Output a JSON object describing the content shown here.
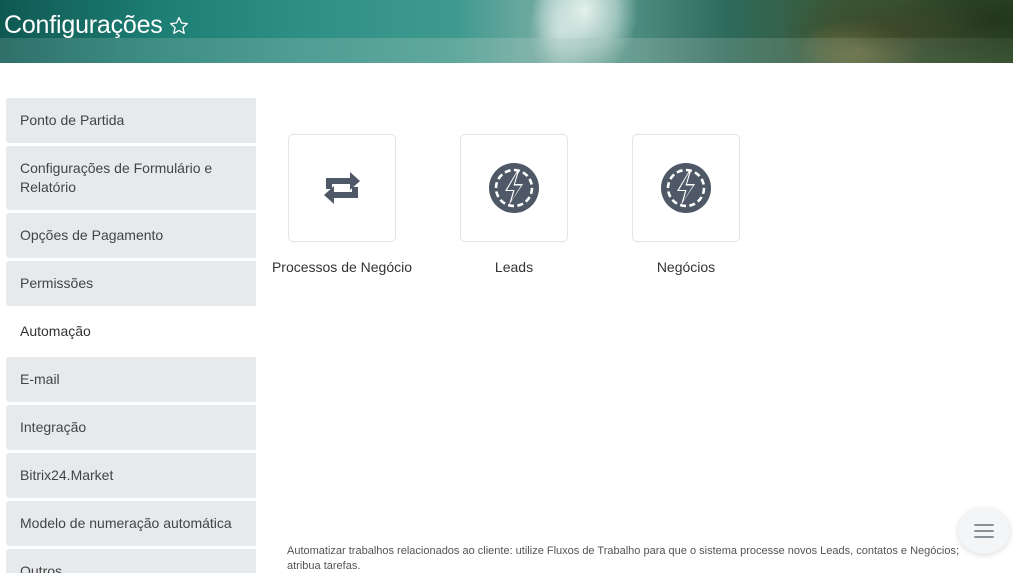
{
  "header": {
    "title": "Configurações"
  },
  "sidebar": {
    "items": [
      {
        "label": "Ponto de Partida",
        "active": false
      },
      {
        "label": "Configurações de Formulário e Relatório",
        "active": false
      },
      {
        "label": "Opções de Pagamento",
        "active": false
      },
      {
        "label": "Permissões",
        "active": false
      },
      {
        "label": "Automação",
        "active": true
      },
      {
        "label": "E-mail",
        "active": false
      },
      {
        "label": "Integração",
        "active": false
      },
      {
        "label": "Bitrix24.Market",
        "active": false
      },
      {
        "label": "Modelo de numeração automática",
        "active": false
      },
      {
        "label": "Outros",
        "active": false
      }
    ]
  },
  "tiles": [
    {
      "label": "Processos de Negócio",
      "icon": "refresh-arrows-icon"
    },
    {
      "label": "Leads",
      "icon": "lightning-gear-icon"
    },
    {
      "label": "Negócios",
      "icon": "lightning-gear-icon"
    }
  ],
  "footer": {
    "description": "Automatizar trabalhos relacionados ao cliente: utilize Fluxos de Trabalho para que o sistema processe novos Leads, contatos e Negócios; atribua tarefas."
  },
  "colors": {
    "sidebar_bg": "#e6eaed",
    "icon": "#4e5866",
    "title": "#ffffff"
  }
}
